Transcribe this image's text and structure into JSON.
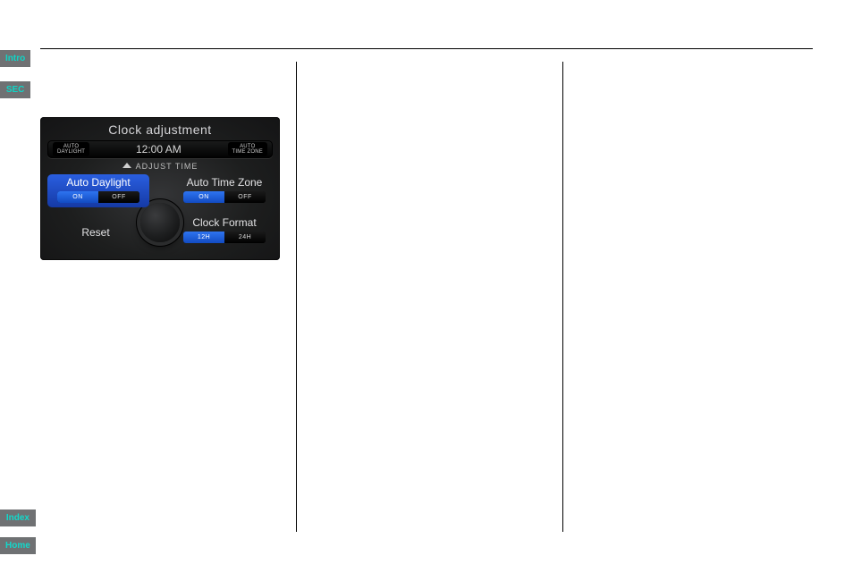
{
  "tabs": {
    "intro": "Intro",
    "sec": "SEC",
    "index": "Index",
    "home": "Home"
  },
  "car_display": {
    "title": "Clock adjustment",
    "time": "12:00 AM",
    "chip_left_line1": "AUTO",
    "chip_left_line2": "DAYLIGHT",
    "chip_right_line1": "AUTO",
    "chip_right_line2": "TIME ZONE",
    "adjust_label": "ADJUST TIME",
    "auto_daylight": {
      "label": "Auto Daylight",
      "on": "ON",
      "off": "OFF"
    },
    "auto_timezone": {
      "label": "Auto Time Zone",
      "on": "ON",
      "off": "OFF"
    },
    "reset": {
      "label": "Reset"
    },
    "clock_format": {
      "label": "Clock Format",
      "on": "12H",
      "off": "24H"
    }
  }
}
